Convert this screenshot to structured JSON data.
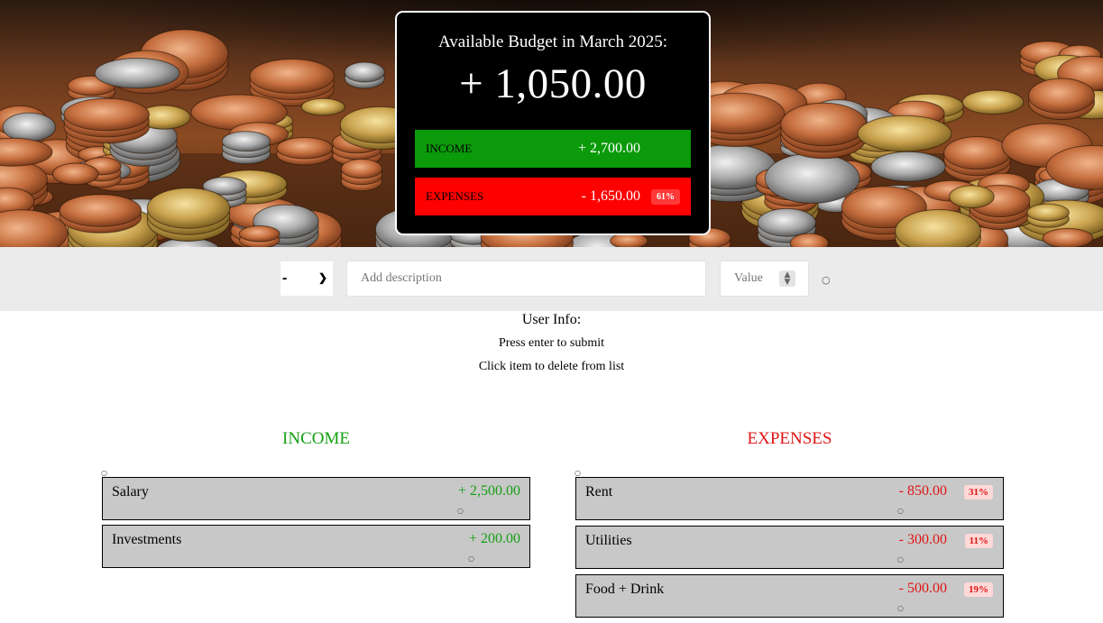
{
  "budget": {
    "title": "Available Budget in March 2025:",
    "value": "+ 1,050.00",
    "income_label": "Income",
    "income_value": "+ 2,700.00",
    "expenses_label": "Expenses",
    "expenses_value": "- 1,650.00",
    "expenses_percentage": "61%"
  },
  "add_form": {
    "type_selected": "-",
    "description_placeholder": "Add description",
    "value_placeholder": "Value",
    "submit_icon": "circle-icon"
  },
  "info": {
    "title": "User Info:",
    "lines": [
      "Press enter to submit",
      "Click item to delete from list"
    ]
  },
  "income": {
    "title": "Income",
    "items": [
      {
        "description": "Salary",
        "value": "+ 2,500.00"
      },
      {
        "description": "Investments",
        "value": "+ 200.00"
      }
    ]
  },
  "expenses": {
    "title": "Expenses",
    "items": [
      {
        "description": "Rent",
        "value": "- 850.00",
        "percentage": "31%"
      },
      {
        "description": "Utilities",
        "value": "- 300.00",
        "percentage": "11%"
      },
      {
        "description": "Food + Drink",
        "value": "- 500.00",
        "percentage": "19%"
      }
    ]
  },
  "colors": {
    "income": "#14a014",
    "expense": "#e01414",
    "income_bar": "#0a9a0a",
    "expense_bar": "#ff0000"
  }
}
